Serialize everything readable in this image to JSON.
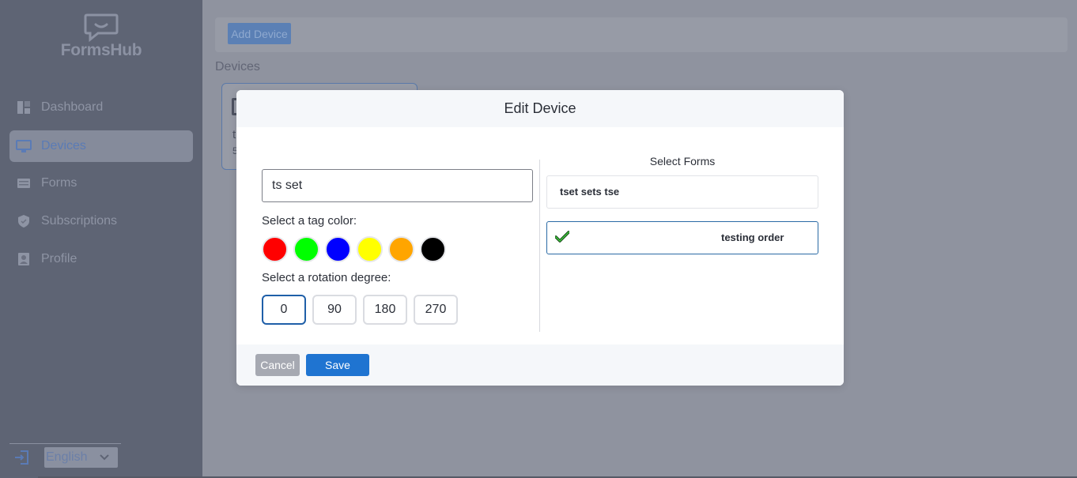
{
  "app": {
    "name": "FormsHub"
  },
  "sidebar": {
    "items": [
      {
        "label": "Dashboard",
        "icon": "dashboard-icon"
      },
      {
        "label": "Devices",
        "icon": "monitor-icon",
        "active": true
      },
      {
        "label": "Forms",
        "icon": "forms-icon"
      },
      {
        "label": "Subscriptions",
        "icon": "shield-icon"
      },
      {
        "label": "Profile",
        "icon": "profile-icon"
      }
    ],
    "language": "English"
  },
  "main": {
    "add_device_label": "Add Device",
    "devices_label": "Devices",
    "card": {
      "line1": "t",
      "line2": "5"
    }
  },
  "modal": {
    "title": "Edit Device",
    "device_name_value": "ts set",
    "tag_color_label": "Select a tag color:",
    "tag_colors": [
      "#ff0000",
      "#00ff00",
      "#0000ff",
      "#ffff00",
      "#ffa500",
      "#000000"
    ],
    "rotation_label": "Select a rotation degree:",
    "rotations": [
      "0",
      "90",
      "180",
      "270"
    ],
    "selected_rotation": "0",
    "forms_title": "Select Forms",
    "forms": [
      {
        "name": "tset sets tse",
        "selected": false
      },
      {
        "name": "testing order",
        "selected": true
      }
    ],
    "cancel_label": "Cancel",
    "save_label": "Save"
  },
  "colors": {
    "accent": "#1f74d1",
    "sidebar_bg": "#5e6474",
    "overlay_bg": "#8f939f"
  }
}
